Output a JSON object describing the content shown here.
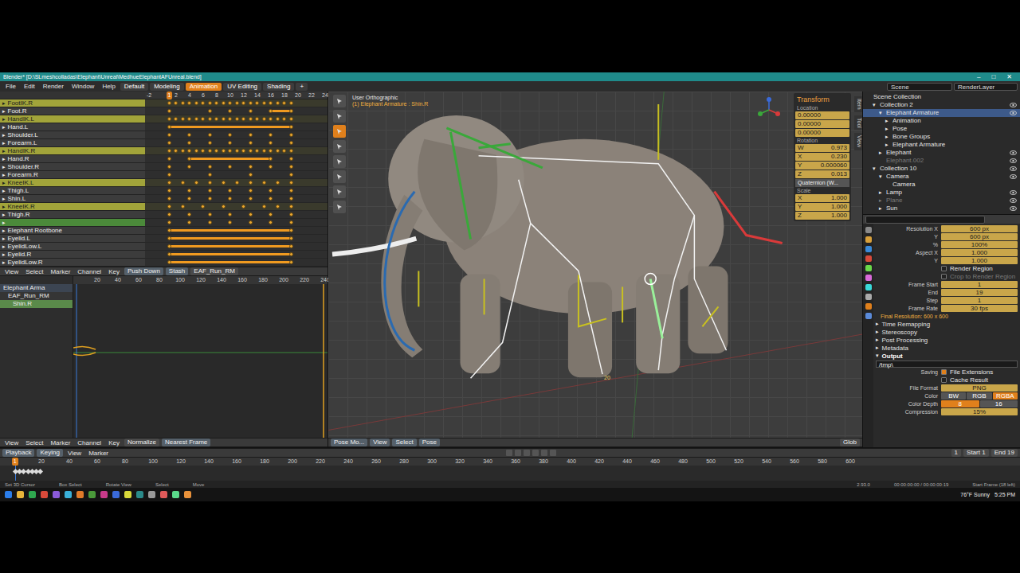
{
  "window": {
    "title": "Blender* [D:\\SLmeshcolladas\\Elephant\\Unreal\\MedhueElephantAFUnreal.blend]",
    "controls": [
      "–",
      "□",
      "✕"
    ]
  },
  "menu": [
    "File",
    "Edit",
    "Render",
    "Window",
    "Help"
  ],
  "workspaces": [
    {
      "label": "Default",
      "selected": false
    },
    {
      "label": "Modeling",
      "selected": false
    },
    {
      "label": "Animation",
      "selected": true
    },
    {
      "label": "UV Editing",
      "selected": false
    },
    {
      "label": "Shading",
      "selected": false
    },
    {
      "label": "+",
      "selected": false
    }
  ],
  "scene": {
    "scene": "Scene",
    "layer": "RenderLayer"
  },
  "dopesheet": {
    "expander": "▸",
    "current_frame": "1",
    "ruler": [
      "-2",
      "2",
      "4",
      "6",
      "8",
      "10",
      "12",
      "14",
      "16",
      "18",
      "20",
      "22",
      "24"
    ],
    "channels": [
      {
        "name": "FootIK.R",
        "highlighted": true,
        "selected": false,
        "keys": [
          1,
          2,
          3,
          4,
          5,
          6,
          7,
          8,
          9,
          10,
          11,
          12,
          13,
          14,
          15,
          16,
          17,
          18,
          19
        ],
        "hold": []
      },
      {
        "name": "Foot.R",
        "highlighted": false,
        "selected": false,
        "keys": [
          1,
          7,
          10,
          13,
          16,
          19
        ],
        "hold": [
          16,
          19
        ]
      },
      {
        "name": "HandIK.L",
        "highlighted": true,
        "selected": false,
        "keys": [
          1,
          2,
          3,
          4,
          5,
          6,
          7,
          8,
          9,
          10,
          11,
          12,
          13,
          14,
          15,
          16,
          17,
          18,
          19
        ],
        "hold": []
      },
      {
        "name": "Hand.L",
        "highlighted": false,
        "selected": false,
        "keys": [
          1,
          19
        ],
        "hold": [
          1,
          19
        ]
      },
      {
        "name": "Shoulder.L",
        "highlighted": false,
        "selected": false,
        "keys": [
          1,
          4,
          7,
          10,
          13,
          16,
          19
        ],
        "hold": []
      },
      {
        "name": "Forearm.L",
        "highlighted": false,
        "selected": false,
        "keys": [
          1,
          4,
          7,
          10,
          13,
          16,
          19
        ],
        "hold": []
      },
      {
        "name": "HandIK.R",
        "highlighted": true,
        "selected": false,
        "keys": [
          1,
          2,
          3,
          4,
          5,
          6,
          7,
          8,
          9,
          10,
          11,
          12,
          13,
          14,
          15,
          16,
          17,
          18,
          19
        ],
        "hold": []
      },
      {
        "name": "Hand.R",
        "highlighted": false,
        "selected": false,
        "keys": [
          1,
          4,
          16,
          19
        ],
        "hold": [
          4,
          16
        ]
      },
      {
        "name": "Shoulder.R",
        "highlighted": false,
        "selected": false,
        "keys": [
          1,
          4,
          7,
          10,
          13,
          16,
          19
        ],
        "hold": []
      },
      {
        "name": "Forearm.R",
        "highlighted": false,
        "selected": false,
        "keys": [
          1,
          7,
          13,
          19
        ],
        "hold": []
      },
      {
        "name": "KneeIK.L",
        "highlighted": true,
        "selected": false,
        "keys": [
          1,
          3,
          5,
          7,
          9,
          11,
          13,
          15,
          17,
          19
        ],
        "hold": []
      },
      {
        "name": "Thigh.L",
        "highlighted": false,
        "selected": false,
        "keys": [
          1,
          4,
          7,
          10,
          13,
          16,
          19
        ],
        "hold": []
      },
      {
        "name": "Shin.L",
        "highlighted": false,
        "selected": false,
        "keys": [
          1,
          4,
          7,
          10,
          13,
          16,
          19
        ],
        "hold": []
      },
      {
        "name": "KneeIK.R",
        "highlighted": true,
        "selected": false,
        "keys": [
          1,
          3,
          6,
          9,
          12,
          15,
          17,
          19
        ],
        "hold": []
      },
      {
        "name": "Thigh.R",
        "highlighted": false,
        "selected": false,
        "keys": [
          1,
          4,
          7,
          10,
          13,
          16,
          19
        ],
        "hold": []
      },
      {
        "name": "",
        "highlighted": false,
        "selected": true,
        "keys": [
          1,
          4,
          7,
          10,
          13,
          16,
          19
        ],
        "hold": []
      },
      {
        "name": "Elephant Rootbone",
        "highlighted": false,
        "selected": false,
        "keys": [
          1,
          19
        ],
        "hold": [
          1,
          19
        ]
      },
      {
        "name": "Eyelid.L",
        "highlighted": false,
        "selected": false,
        "keys": [
          1,
          19
        ],
        "hold": [
          1,
          19
        ]
      },
      {
        "name": "EyelidLow.L",
        "highlighted": false,
        "selected": false,
        "keys": [
          1,
          19
        ],
        "hold": [
          1,
          19
        ]
      },
      {
        "name": "Eyelid.R",
        "highlighted": false,
        "selected": false,
        "keys": [
          1,
          19
        ],
        "hold": [
          1,
          19
        ]
      },
      {
        "name": "EyelidLow.R",
        "highlighted": false,
        "selected": false,
        "keys": [
          1,
          19
        ],
        "hold": [
          1,
          19
        ]
      }
    ],
    "header": {
      "menus": [
        "View",
        "Select",
        "Marker",
        "Channel",
        "Key"
      ],
      "buttons": [
        "Push Down",
        "Stash"
      ],
      "action": "EAF_Run_RM"
    }
  },
  "graph": {
    "channels": [
      {
        "name": "Elephant Arma",
        "selected": false
      },
      {
        "name": "EAF_Run_RM",
        "selected": false
      },
      {
        "name": "Shin.R",
        "selected": true
      }
    ],
    "ruler": [
      "20",
      "40",
      "60",
      "80",
      "100",
      "120",
      "140",
      "160",
      "180",
      "200",
      "220",
      "240"
    ],
    "header": {
      "menus": [
        "View",
        "Select",
        "Marker",
        "Channel",
        "Key"
      ],
      "normalize": "Normalize",
      "snap": "Nearest Frame"
    }
  },
  "viewport": {
    "view": "User Orthographic",
    "object": "(1) Elephant Armature : Shin.R",
    "frame_label": "20",
    "tabs": [
      "Item",
      "Tool",
      "View"
    ],
    "transform": {
      "title": "Transform",
      "location_label": "Location",
      "location": [
        "0.00000",
        "0.00000",
        "0.00000"
      ],
      "rotation_label": "Rotation",
      "rotation": [
        {
          "axis": "W",
          "value": "0.973"
        },
        {
          "axis": "X",
          "value": "0.230"
        },
        {
          "axis": "Y",
          "value": "0.000060"
        },
        {
          "axis": "Z",
          "value": "0.013"
        }
      ],
      "rotation_mode": "Quaternion (W...",
      "scale_label": "Scale",
      "scale": [
        {
          "axis": "X",
          "value": "1.000"
        },
        {
          "axis": "Y",
          "value": "1.000"
        },
        {
          "axis": "Z",
          "value": "1.000"
        }
      ]
    },
    "header": {
      "mode": "Pose Mo...",
      "menus": [
        "View",
        "Select",
        "Pose"
      ],
      "orientation": "Glob"
    }
  },
  "outliner": [
    {
      "label": "Scene Collection",
      "depth": 0,
      "toggle": "",
      "selected": false,
      "greyed": false,
      "visible": false
    },
    {
      "label": "Collection 2",
      "depth": 1,
      "toggle": "▾",
      "selected": false,
      "greyed": false,
      "visible": true
    },
    {
      "label": "Elephant Armature",
      "depth": 2,
      "toggle": "▾",
      "selected": true,
      "greyed": false,
      "visible": true
    },
    {
      "label": "Animation",
      "depth": 3,
      "toggle": "▸",
      "selected": false,
      "greyed": false,
      "visible": false
    },
    {
      "label": "Pose",
      "depth": 3,
      "toggle": "▸",
      "selected": false,
      "greyed": false,
      "visible": false
    },
    {
      "label": "Bone Groups",
      "depth": 3,
      "toggle": "▸",
      "selected": false,
      "greyed": false,
      "visible": false
    },
    {
      "label": "Elephant Armature",
      "depth": 3,
      "toggle": "▸",
      "selected": false,
      "greyed": false,
      "visible": false
    },
    {
      "label": "Elephant",
      "depth": 2,
      "toggle": "▸",
      "selected": false,
      "greyed": false,
      "visible": true
    },
    {
      "label": "Elephant.002",
      "depth": 2,
      "toggle": "",
      "selected": false,
      "greyed": true,
      "visible": true
    },
    {
      "label": "Collection 10",
      "depth": 1,
      "toggle": "▾",
      "selected": false,
      "greyed": false,
      "visible": true
    },
    {
      "label": "Camera",
      "depth": 2,
      "toggle": "▾",
      "selected": false,
      "greyed": false,
      "visible": true
    },
    {
      "label": "Camera",
      "depth": 3,
      "toggle": "",
      "selected": false,
      "greyed": false,
      "visible": false
    },
    {
      "label": "Lamp",
      "depth": 2,
      "toggle": "▸",
      "selected": false,
      "greyed": false,
      "visible": true
    },
    {
      "label": "Plane",
      "depth": 2,
      "toggle": "▸",
      "selected": false,
      "greyed": true,
      "visible": true
    },
    {
      "label": "Sun",
      "depth": 2,
      "toggle": "▸",
      "selected": false,
      "greyed": false,
      "visible": true
    }
  ],
  "properties": [
    {
      "kind": "field",
      "label": "Resolution X",
      "value": "600 px"
    },
    {
      "kind": "field",
      "label": "Y",
      "value": "600 px"
    },
    {
      "kind": "field",
      "label": "%",
      "value": "100%"
    },
    {
      "kind": "field",
      "label": "Aspect X",
      "value": "1.000"
    },
    {
      "kind": "field",
      "label": "Y",
      "value": "1.000"
    },
    {
      "kind": "check",
      "label": "Render Region",
      "checked": false,
      "disabled": false
    },
    {
      "kind": "check",
      "label": "Crop to Render Region",
      "checked": false,
      "disabled": true
    },
    {
      "kind": "field",
      "label": "Frame Start",
      "value": "1"
    },
    {
      "kind": "field",
      "label": "End",
      "value": "19"
    },
    {
      "kind": "field",
      "label": "Step",
      "value": "1"
    },
    {
      "kind": "field",
      "label": "Frame Rate",
      "value": "30 fps"
    },
    {
      "kind": "note",
      "label": "Final Resolution: 600 x 600"
    },
    {
      "kind": "section",
      "label": "Time Remapping",
      "toggle": "▸",
      "expanded": false
    },
    {
      "kind": "section",
      "label": "Stereoscopy",
      "toggle": "▸",
      "expanded": false
    },
    {
      "kind": "section",
      "label": "Post Processing",
      "toggle": "▸",
      "expanded": false
    },
    {
      "kind": "section",
      "label": "Metadata",
      "toggle": "▸",
      "expanded": false
    },
    {
      "kind": "section",
      "label": "Output",
      "toggle": "▾",
      "expanded": true
    },
    {
      "kind": "path",
      "value": "/tmp\\"
    },
    {
      "kind": "check",
      "label": "File Extensions",
      "checked": true,
      "disabled": false,
      "caption": "Saving"
    },
    {
      "kind": "check",
      "label": "Cache Result",
      "checked": false,
      "disabled": false
    },
    {
      "kind": "field",
      "label": "File Format",
      "value": "PNG"
    },
    {
      "kind": "choice",
      "label": "Color",
      "options": [
        {
          "label": "BW",
          "selected": false
        },
        {
          "label": "RGB",
          "selected": false
        },
        {
          "label": "RGBA",
          "selected": true
        }
      ]
    },
    {
      "kind": "choice",
      "label": "Color Depth",
      "options": [
        {
          "label": "8",
          "selected": true
        },
        {
          "label": "16",
          "selected": false
        }
      ]
    },
    {
      "kind": "field",
      "label": "Compression",
      "value": "15%"
    }
  ],
  "timeline": {
    "menus": [
      "Playback",
      "Keying",
      "View",
      "Marker"
    ],
    "current_frame": "1",
    "start": {
      "label": "Start",
      "value": "1"
    },
    "end": {
      "label": "End",
      "value": "19"
    },
    "ruler": [
      "20",
      "40",
      "60",
      "80",
      "100",
      "120",
      "140",
      "160",
      "180",
      "200",
      "220",
      "240",
      "260",
      "280",
      "300",
      "320",
      "340",
      "360",
      "380",
      "400",
      "420",
      "440",
      "460",
      "480",
      "500",
      "520",
      "540",
      "560",
      "580",
      "600"
    ],
    "keys": [
      1,
      4,
      7,
      10,
      13,
      16,
      19
    ]
  },
  "status_bar": {
    "hints": [
      "Set 3D Cursor",
      "Box Select",
      "Rotate View",
      "Select",
      "Move"
    ],
    "version": "2.93.0",
    "time": "00:00:00:00 / 00:00:00:19",
    "info": "Start Frame (18 left)"
  },
  "taskbar": {
    "apps": [
      {
        "color": "#2b7de9"
      },
      {
        "color": "#e8b53a"
      },
      {
        "color": "#2fa84f"
      },
      {
        "color": "#d94a3a"
      },
      {
        "color": "#8a5ad9"
      },
      {
        "color": "#3ab0d9"
      },
      {
        "color": "#e07b2a"
      },
      {
        "color": "#4a9a3a"
      },
      {
        "color": "#c83a8a"
      },
      {
        "color": "#3a6ad9"
      },
      {
        "color": "#d9d93a"
      },
      {
        "color": "#2a8a8a"
      },
      {
        "color": "#9a9a9a"
      },
      {
        "color": "#e05a5a"
      },
      {
        "color": "#5ad98a"
      },
      {
        "color": "#e8913a"
      }
    ],
    "weather": "76°F Sunny",
    "clock": "5:25 PM"
  }
}
